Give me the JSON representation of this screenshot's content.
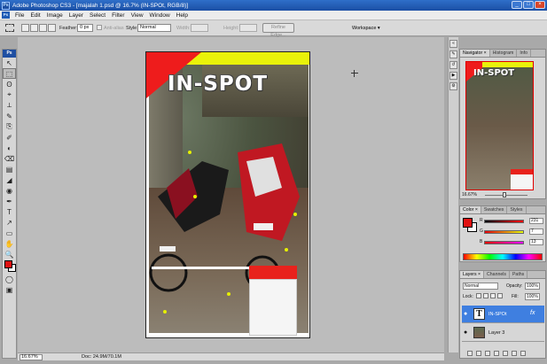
{
  "window": {
    "title": "Adobe Photoshop CS3 - [majalah 1.psd @ 16.7% (IN-SPOt, RGB/8)]",
    "logo_text": "Ps",
    "min": "_",
    "max": "□",
    "close": "×"
  },
  "menu": {
    "logo_text": "Ps",
    "items": [
      "File",
      "Edit",
      "Image",
      "Layer",
      "Select",
      "Filter",
      "View",
      "Window",
      "Help"
    ]
  },
  "options": {
    "feather_label": "Feather:",
    "feather_value": "0 px",
    "antialias_label": "Anti-alias",
    "style_label": "Style:",
    "style_value": "Normal",
    "width_label": "Width:",
    "height_label": "Height:",
    "refine_label": "Refine Edge...",
    "workspace_label": "Workspace ▾"
  },
  "toolbox": {
    "header": "Ps",
    "tools": [
      "↖",
      "⬚",
      "ʘ",
      "⌖",
      "⟂",
      "✎",
      "⎘",
      "✐",
      "◐",
      "⌫",
      "▤",
      "◢",
      "◉",
      "✒",
      "T",
      "↗",
      "▭",
      "✋",
      "🔍"
    ]
  },
  "document": {
    "cover_title": "IN-SPOT",
    "zoom": "16.67%",
    "doc_size": "Doc: 24.9M/70.1M"
  },
  "navigator": {
    "tabs": [
      "Navigator ×",
      "Histogram",
      "Info"
    ],
    "zoom": "16.67%",
    "thumb_title": "IN-SPOT"
  },
  "color": {
    "tabs": [
      "Color ×",
      "Swatches",
      "Styles"
    ],
    "channels": [
      {
        "label": "R",
        "value": "231"
      },
      {
        "label": "G",
        "value": "7"
      },
      {
        "label": "B",
        "value": "13"
      }
    ]
  },
  "layers": {
    "tabs": [
      "Layers ×",
      "Channels",
      "Paths"
    ],
    "blend_mode": "Normal",
    "opacity_label": "Opacity:",
    "opacity_value": "100%",
    "lock_label": "Lock:",
    "fill_label": "Fill:",
    "fill_value": "100%",
    "items": [
      {
        "name": "IN-SPOt",
        "thumb": "T",
        "fx": "fx"
      },
      {
        "name": "Layer 3"
      }
    ]
  },
  "colors": {
    "foreground": "#e01010",
    "cover_red": "#ee1c1c",
    "cover_yellow": "#e9f20a",
    "title_bar": "#1b4fa4"
  }
}
